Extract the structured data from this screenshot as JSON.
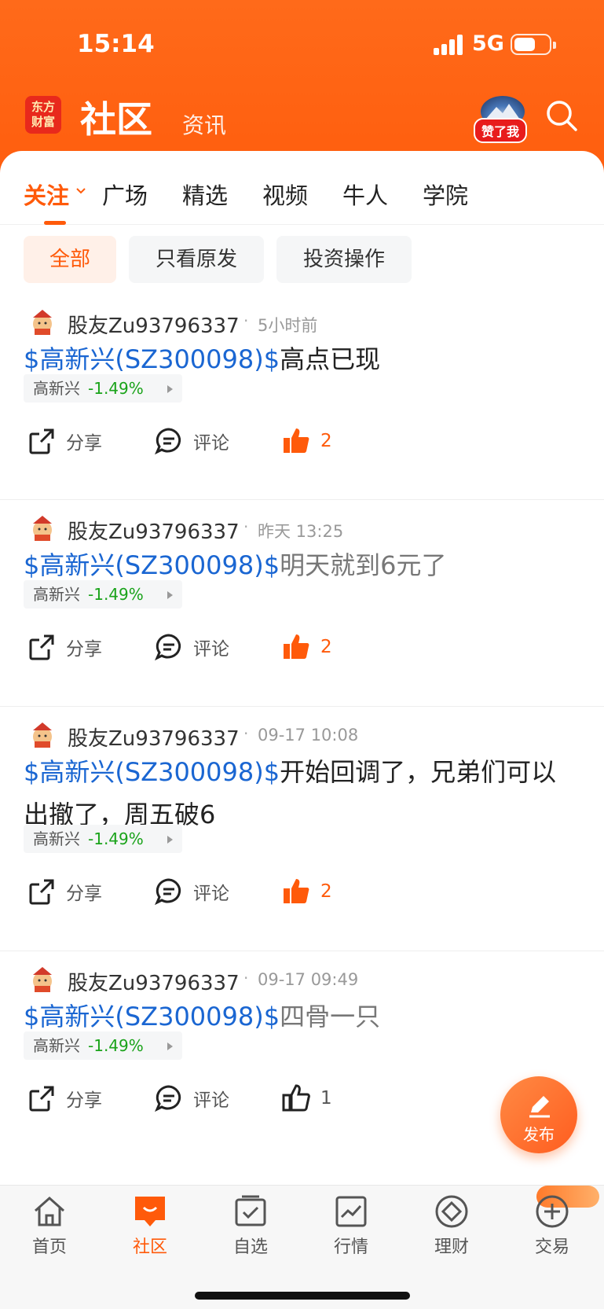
{
  "status_bar": {
    "time": "15:14",
    "network": "5G"
  },
  "header": {
    "logo_line1": "东方",
    "logo_line2": "财富",
    "title": "社区",
    "subtitle": "资讯",
    "like_badge": "赞了我"
  },
  "tabs": [
    "关注",
    "广场",
    "精选",
    "视频",
    "牛人",
    "学院"
  ],
  "chips": [
    "全部",
    "只看原发",
    "投资操作"
  ],
  "posts": [
    {
      "author": "股友Zu93796337",
      "time": "5小时前",
      "stock": "$高新兴(SZ300098)$",
      "text": "高点已现",
      "text_gray": "",
      "tag_name": "高新兴",
      "tag_change": "-1.49%",
      "share": "分享",
      "comment": "评论",
      "likes": "2"
    },
    {
      "author": "股友Zu93796337",
      "time": "昨天 13:25",
      "stock": "$高新兴(SZ300098)$",
      "text": "",
      "text_gray": "明天就到6元了",
      "tag_name": "高新兴",
      "tag_change": "-1.49%",
      "share": "分享",
      "comment": "评论",
      "likes": "2"
    },
    {
      "author": "股友Zu93796337",
      "time": "09-17 10:08",
      "stock": "$高新兴(SZ300098)$",
      "text": "开始回调了，兄弟们可以出撤了，周五破6",
      "text_gray": "",
      "tag_name": "高新兴",
      "tag_change": "-1.49%",
      "share": "分享",
      "comment": "评论",
      "likes": "2"
    },
    {
      "author": "股友Zu93796337",
      "time": "09-17 09:49",
      "stock": "$高新兴(SZ300098)$",
      "text": "",
      "text_gray": "四骨一只",
      "tag_name": "高新兴",
      "tag_change": "-1.49%",
      "share": "分享",
      "comment": "评论",
      "likes": "1"
    }
  ],
  "fab_label": "发布",
  "bottom_nav": [
    "首页",
    "社区",
    "自选",
    "行情",
    "理财",
    "交易"
  ],
  "colors": {
    "brand": "#ff5a0a",
    "stock_link": "#1a66d2",
    "down": "#1aa31a"
  }
}
